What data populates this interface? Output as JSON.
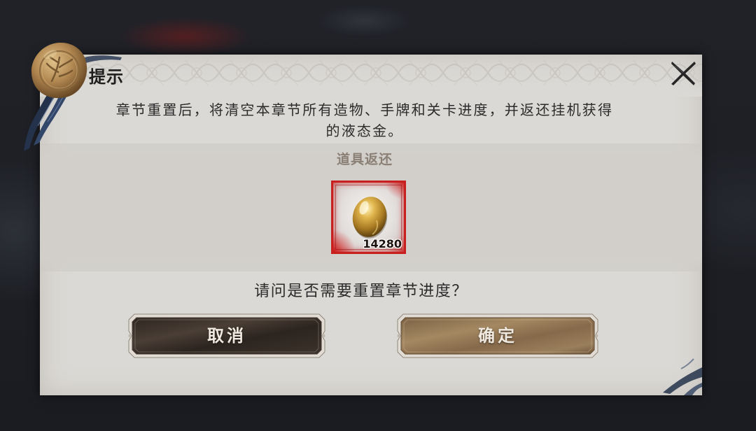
{
  "dialog": {
    "title": "提示",
    "message_lines": [
      "章节重置后，将清空本章节所有造物、手牌和关卡进度，并返还挂机获得",
      "的液态金。"
    ],
    "rewards_label": "道具返还",
    "rewards": [
      {
        "icon": "liquid-gold-egg-icon",
        "count": "14280"
      }
    ],
    "question": "请问是否需要重置章节进度？",
    "cancel_button": {
      "label": "取消"
    },
    "confirm_button": {
      "label": "确定"
    },
    "close_icon": "close-x-icon",
    "seal_icon": "wax-seal-icon"
  },
  "colors": {
    "backdrop": "#1c1e24",
    "panel": "#dbd9d5",
    "panel_band": "#d2cfca",
    "title_text": "#1e1e1e",
    "body_text": "#2b2b2b",
    "muted_text": "#8b8076",
    "button_text": "#efe9df",
    "cancel_fill": "#3a3029",
    "confirm_fill": "#8b704f",
    "rarity_red": "#c81f1f",
    "ribbon": "#24334b",
    "wax_gold": "#b08650"
  }
}
